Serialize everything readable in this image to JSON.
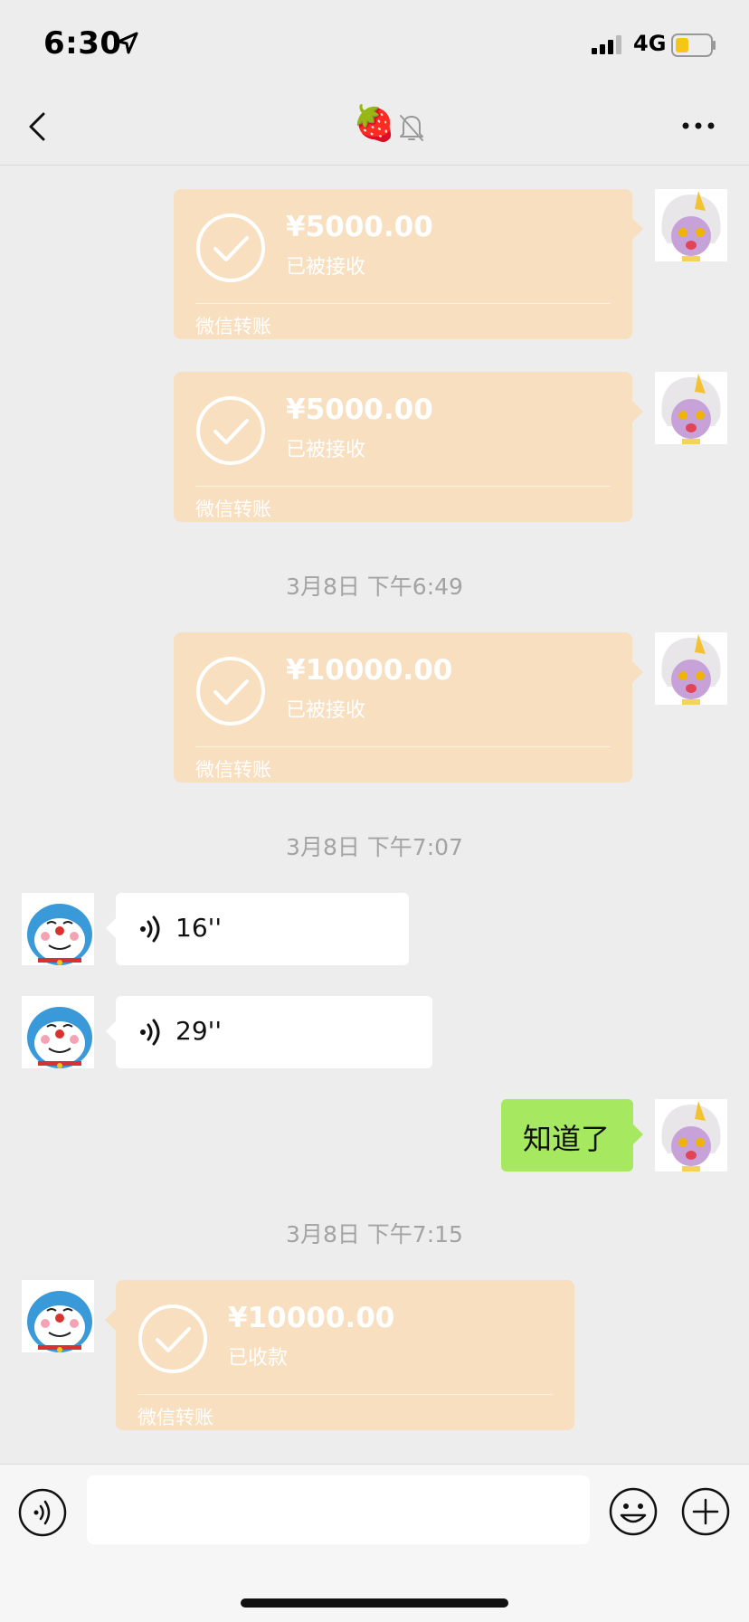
{
  "status_bar": {
    "time": "6:30",
    "network": "4G"
  },
  "nav": {
    "title": "🍓"
  },
  "messages": [
    {
      "type": "transfer",
      "from": "me",
      "amount": "¥5000.00",
      "status": "已被接收",
      "footer": "微信转账"
    },
    {
      "type": "transfer",
      "from": "me",
      "amount": "¥5000.00",
      "status": "已被接收",
      "footer": "微信转账"
    },
    {
      "type": "timestamp",
      "text": "3月8日 下午6:49"
    },
    {
      "type": "transfer",
      "from": "me",
      "amount": "¥10000.00",
      "status": "已被接收",
      "footer": "微信转账"
    },
    {
      "type": "timestamp",
      "text": "3月8日 下午7:07"
    },
    {
      "type": "voice",
      "from": "other",
      "duration": "16''"
    },
    {
      "type": "voice",
      "from": "other",
      "duration": "29''"
    },
    {
      "type": "text",
      "from": "me",
      "text": "知道了"
    },
    {
      "type": "timestamp",
      "text": "3月8日 下午7:15"
    },
    {
      "type": "transfer",
      "from": "other",
      "amount": "¥10000.00",
      "status": "已收款",
      "footer": "微信转账"
    }
  ],
  "input": {
    "placeholder": ""
  },
  "colors": {
    "transfer_bg": "#f7dfc0",
    "my_bubble": "#a6e860",
    "chat_bg": "#ededed"
  }
}
